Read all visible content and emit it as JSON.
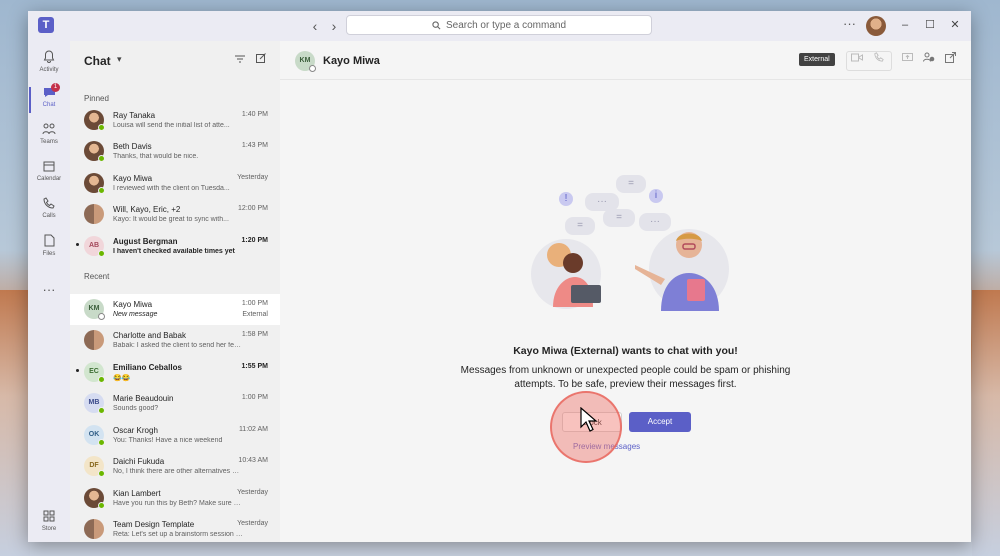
{
  "titlebar": {
    "logo": "T",
    "back_icon": "‹",
    "forward_icon": "›",
    "search_placeholder": "Search or type a command",
    "more": "···",
    "minimize": "–",
    "maximize": "☐",
    "close": "✕"
  },
  "appbar": {
    "items": [
      {
        "label": "Activity",
        "icon": "bell-icon"
      },
      {
        "label": "Chat",
        "icon": "chat-icon",
        "badge": "1"
      },
      {
        "label": "Teams",
        "icon": "teams-icon"
      },
      {
        "label": "Calendar",
        "icon": "calendar-icon"
      },
      {
        "label": "Calls",
        "icon": "phone-icon"
      },
      {
        "label": "Files",
        "icon": "file-icon"
      }
    ],
    "more": "···",
    "store_label": "Store"
  },
  "chatlist": {
    "title": "Chat",
    "pinned_label": "Pinned",
    "recent_label": "Recent",
    "pinned": [
      {
        "name": "Ray Tanaka",
        "preview": "Louisa will send the initial list of atte...",
        "time": "1:40 PM"
      },
      {
        "name": "Beth Davis",
        "preview": "Thanks, that would be nice.",
        "time": "1:43 PM"
      },
      {
        "name": "Kayo Miwa",
        "preview": "I reviewed with the client on Tuesda...",
        "time": "Yesterday"
      },
      {
        "name": "Will, Kayo, Eric, +2",
        "preview": "Kayo: It would be great to sync with...",
        "time": "12:00 PM"
      },
      {
        "name": "August Bergman",
        "initials": "AB",
        "preview": "I haven't checked available times yet",
        "time": "1:20 PM"
      }
    ],
    "recent": [
      {
        "name": "Kayo Miwa",
        "initials": "KM",
        "preview": "New message",
        "time": "1:00 PM",
        "external": "External"
      },
      {
        "name": "Charlotte and Babak",
        "preview": "Babak: I asked the client to send her feed...",
        "time": "1:58 PM"
      },
      {
        "name": "Emiliano Ceballos",
        "initials": "EC",
        "preview": "😂😂",
        "time": "1:55 PM"
      },
      {
        "name": "Marie Beaudouin",
        "initials": "MB",
        "preview": "Sounds good?",
        "time": "1:00 PM"
      },
      {
        "name": "Oscar Krogh",
        "initials": "OK",
        "preview": "You: Thanks! Have a nice weekend",
        "time": "11:02 AM"
      },
      {
        "name": "Daichi Fukuda",
        "initials": "DF",
        "preview": "No, I think there are other alternatives we c...",
        "time": "10:43 AM"
      },
      {
        "name": "Kian Lambert",
        "preview": "Have you run this by Beth? Make sure she is...",
        "time": "Yesterday"
      },
      {
        "name": "Team Design Template",
        "preview": "Reta: Let's set up a brainstorm session for...",
        "time": "Yesterday"
      }
    ]
  },
  "main": {
    "contact_initials": "KM",
    "contact_name": "Kayo Miwa",
    "external_tag": "External",
    "prompt_title": "Kayo Miwa (External) wants to chat with you!",
    "prompt_body": "Messages from unknown or unexpected people could be spam or phishing attempts. To be safe, preview their messages first.",
    "block_label": "Block",
    "accept_label": "Accept",
    "preview_link": "Preview messages"
  },
  "colors": {
    "brand": "#5b5fc7",
    "online": "#6bb700",
    "badge": "#c4314b"
  }
}
